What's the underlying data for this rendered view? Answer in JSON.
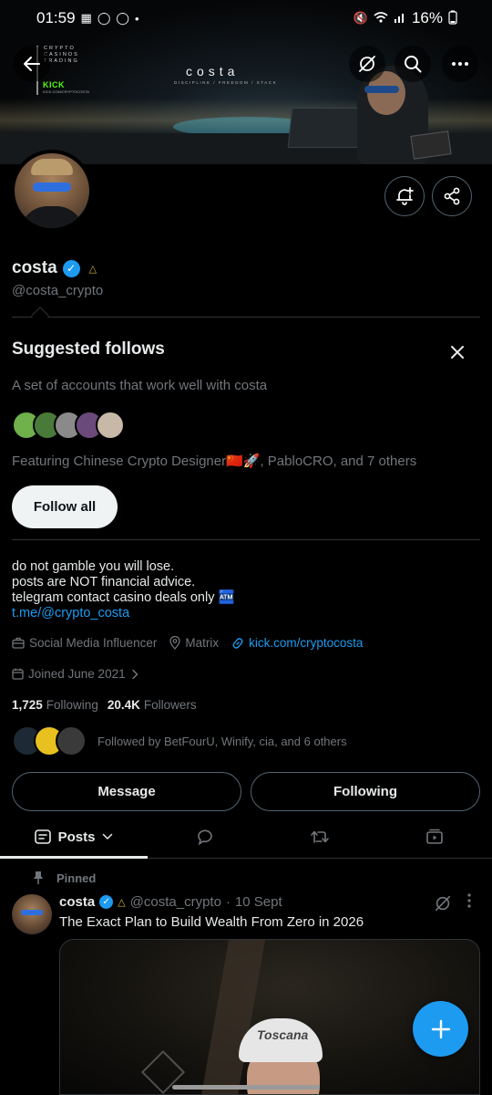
{
  "status_bar": {
    "time": "01:59",
    "battery": "16%",
    "left_icons": [
      "gallery-icon",
      "chat-bubble-icon",
      "chat-bubble-icon",
      "dot-icon"
    ],
    "right_icons": [
      "mute-icon",
      "wifi-icon",
      "signal-icon",
      "battery-icon"
    ]
  },
  "banner": {
    "logo_lines": [
      "CRYPTO",
      "CASINOS",
      "TRADING"
    ],
    "kick_label": "KICK",
    "kick_url": "KICK.COM/CRYPTOCOSTA",
    "brand": "costa",
    "tagline": "DISCIPLINE / FREEDOM / STACK"
  },
  "profile": {
    "name": "costa",
    "handle": "@costa_crypto",
    "bio_lines": [
      "do not gamble you will lose.",
      "posts are NOT financial advice.",
      "telegram contact casino deals only 🏧"
    ],
    "bio_link": "t.me/@crypto_costa",
    "category": "Social Media Influencer",
    "location": "Matrix",
    "website": "kick.com/cryptocosta",
    "joined": "Joined June 2021",
    "following_count": "1,725",
    "following_label": "Following",
    "followers_count": "20.4K",
    "followers_label": "Followers",
    "followed_by": "Followed by BetFourU, Winify, cia, and 6 others"
  },
  "suggested": {
    "title": "Suggested follows",
    "description": "A set of accounts that work well with costa",
    "featuring": "Featuring Chinese Crypto Designer🇨🇳🚀, PabloCRO, and 7 others",
    "follow_all": "Follow all",
    "avatar_colors": [
      "#6fb04a",
      "#4a7a3a",
      "#8a8a8a",
      "#6a4a7a",
      "#c8b8a8"
    ]
  },
  "buttons": {
    "message": "Message",
    "following": "Following"
  },
  "tabs": {
    "posts": "Posts"
  },
  "post": {
    "pinned_label": "Pinned",
    "name": "costa",
    "handle": "@costa_crypto",
    "separator": "·",
    "date": "10 Sept",
    "text": "The Exact Plan to Build Wealth From Zero in 2026",
    "media_cap_text": "Toscana"
  },
  "colors": {
    "accent": "#1d9bf0",
    "background": "#000000",
    "text_primary": "#e7e9ea",
    "text_secondary": "#71767b",
    "border": "#2f3336"
  }
}
